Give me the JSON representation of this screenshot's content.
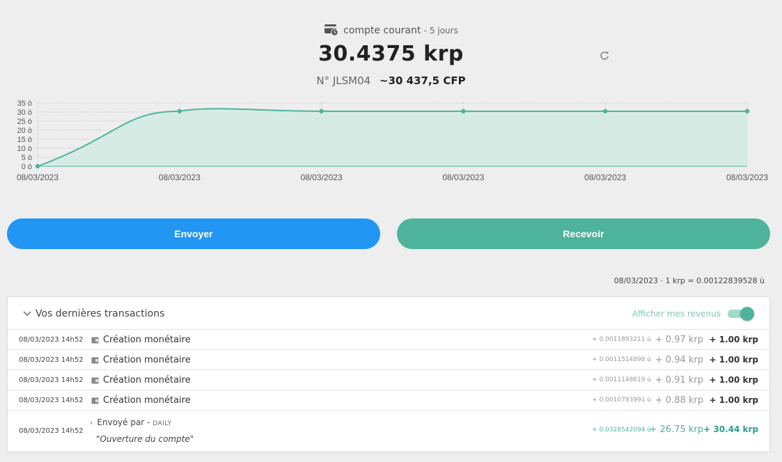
{
  "account": {
    "type_label": "compte courant",
    "days_label": "- 5 jours",
    "balance": "30.4375 krp",
    "number_label": "N° JLSM04",
    "converted": "~30 437,5 CFP"
  },
  "actions": {
    "send_label": "Envoyer",
    "receive_label": "Recevoir"
  },
  "rate_line": "08/03/2023 · 1 krp = 0.00122839528 ù",
  "transactions": {
    "title": "Vos dernières transactions",
    "show_income_label": "Afficher mes revenus",
    "show_income_enabled": true,
    "rows": [
      {
        "date": "08/03/2023 14h52",
        "desc": "Création monétaire",
        "small": "+ 0.0011893211 ù",
        "mid": "+ 0.97 krp",
        "main": "+ 1.00 krp"
      },
      {
        "date": "08/03/2023 14h52",
        "desc": "Création monétaire",
        "small": "+ 0.0011514898 ù",
        "mid": "+ 0.94 krp",
        "main": "+ 1.00 krp"
      },
      {
        "date": "08/03/2023 14h52",
        "desc": "Création monétaire",
        "small": "+ 0.0011148619 ù",
        "mid": "+ 0.91 krp",
        "main": "+ 1.00 krp"
      },
      {
        "date": "08/03/2023 14h52",
        "desc": "Création monétaire",
        "small": "+ 0.0010793991 ù",
        "mid": "+ 0.88 krp",
        "main": "+ 1.00 krp"
      }
    ],
    "last": {
      "date": "08/03/2023 14h52",
      "sent_by": "Envoyé par -",
      "sender": "DAILY",
      "note": "\"Ouverture du compte\"",
      "small": "+ 0.0328542094 ù",
      "mid": "+ 26.75 krp",
      "main": "+ 30.44 krp"
    }
  },
  "colors": {
    "accent": "#4db39a",
    "send": "#2196f3",
    "area_fill": "#d7ebe5"
  },
  "chart_data": {
    "type": "area",
    "x": [
      "08/03/2023",
      "08/03/2023",
      "08/03/2023",
      "08/03/2023",
      "08/03/2023",
      "08/03/2023"
    ],
    "series": [
      {
        "values": [
          0,
          30.44,
          30.44,
          30.44,
          30.44,
          30.44
        ]
      }
    ],
    "yticks": [
      "0 ò",
      "5 ò",
      "10 ò",
      "15 ò",
      "20 ò",
      "25 ò",
      "30 ò",
      "35 ò"
    ],
    "ylim": [
      0,
      35
    ],
    "grid": true
  }
}
